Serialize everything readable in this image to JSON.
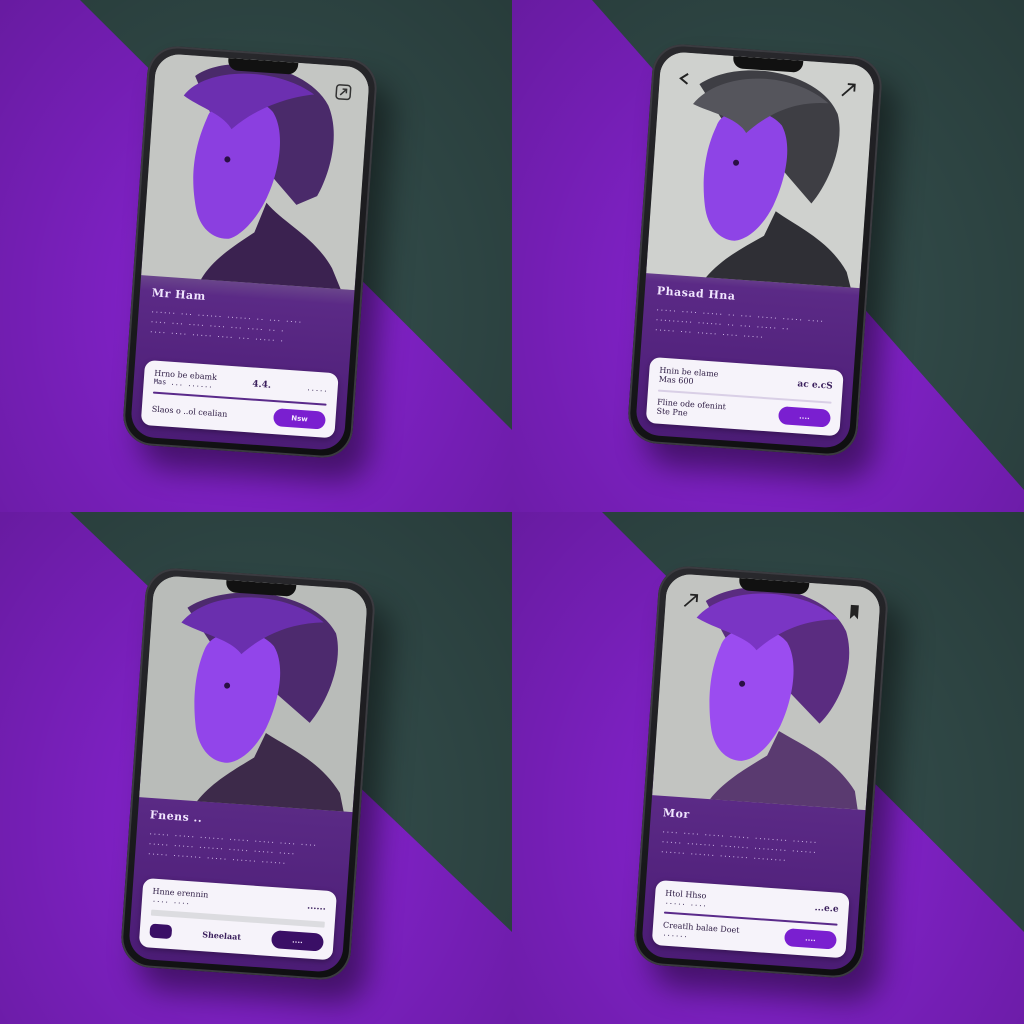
{
  "colors": {
    "accent": "#7a1fd0",
    "background_purple": "#8a24d6",
    "background_teal": "#35504e",
    "panel_purple": "#4b1c75"
  },
  "variants": [
    {
      "corner_left_icon": "",
      "corner_right_icon": "share-icon",
      "info_title": "Mr Ham",
      "info_body": "...... ... ...... ...... .. ... ....\n.... ... .... .... ... .... .. .\n.... .... ..... .... ... ..... .",
      "card_title": "Hrno be ebamk",
      "card_sub": "Mas ... ......",
      "card_price": "4.4.",
      "card_price_extra": ".....",
      "cta_text": "Slaos o ..ol cealian",
      "cta_button": "Nsw"
    },
    {
      "corner_left_icon": "back-icon",
      "corner_right_icon": "share-icon",
      "info_title": "Phasad Hna",
      "info_body": "..... .... ..... .. ... ..... ..... ....\n......... ...... .. ... ..... ..\n..... ... ..... .... .....",
      "card_title": "Hnin be elame",
      "card_sub": "Mas 600",
      "card_price": "ac e.cS",
      "card_price_extra": "",
      "cta_text": "Fline ode ofenint",
      "cta_sub": "Ste Pne",
      "cta_button": "...."
    },
    {
      "corner_left_icon": "",
      "corner_right_icon": "",
      "info_title": "Fnens ..",
      "info_body": "..... ..... ...... ..... ..... .... ....\n..... ..... ...... ..... ..... ....\n..... ....... ..... ...... ......",
      "card_title": "Hnne erennin",
      "card_sub": ".... ....",
      "card_price": "......",
      "card_price_extra": "",
      "cta_text": "Sheelaat",
      "cta_button": "...."
    },
    {
      "corner_left_icon": "share-icon",
      "corner_right_icon": "bookmark-icon",
      "info_title": "Mor",
      "info_body": ".... .... ..... ..... ........ ......\n..... ....... ....... ........ ......\n...... ...... ....... ........",
      "card_title": "Htol Hhso",
      "card_sub": "..... ....",
      "card_price": "...e.e",
      "card_price_extra": "",
      "cta_text": "Creatlh balae Doet",
      "cta_sub": "......",
      "cta_button": "...."
    }
  ]
}
